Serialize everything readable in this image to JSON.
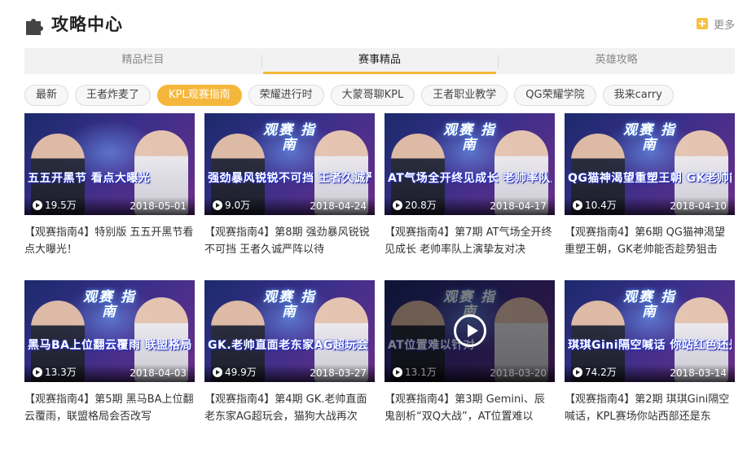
{
  "header": {
    "title": "攻略中心",
    "icon": "puzzle-icon",
    "more_label": "更多",
    "accent": "#f5b73b"
  },
  "tabs": [
    {
      "label": "精品栏目",
      "active": false
    },
    {
      "label": "赛事精品",
      "active": true
    },
    {
      "label": "英雄攻略",
      "active": false
    }
  ],
  "categories": [
    {
      "label": "最新",
      "active": false
    },
    {
      "label": "王者炸麦了",
      "active": false
    },
    {
      "label": "KPL观赛指南",
      "active": true
    },
    {
      "label": "荣耀进行时",
      "active": false
    },
    {
      "label": "大蒙哥聊KPL",
      "active": false
    },
    {
      "label": "王者职业教学",
      "active": false
    },
    {
      "label": "QG荣耀学院",
      "active": false
    },
    {
      "label": "我来carry",
      "active": false
    }
  ],
  "videos": [
    {
      "thumb_text": "五五开黑节 看点大曝光",
      "logo": "",
      "views": "19.5万",
      "date": "2018-05-01",
      "title": "【观赛指南4】特别版 五五开黑节看点大曝光！",
      "hover": false
    },
    {
      "thumb_text": "强劲暴风锐锐不可挡 王者久诚严阵以待",
      "logo": "观赛 指南",
      "views": "9.0万",
      "date": "2018-04-24",
      "title": "【观赛指南4】第8期 强劲暴风锐锐不可挡 王者久诚严阵以待",
      "hover": false
    },
    {
      "thumb_text": "AT气场全开终见成长 老帅率队上演挚友对决",
      "logo": "观赛 指南",
      "views": "20.8万",
      "date": "2018-04-17",
      "title": "【观赛指南4】第7期 AT气场全开终见成长 老帅率队上演挚友对决",
      "hover": false
    },
    {
      "thumb_text": "QG猫神渴望重塑王朝 GK老帅能否趁势狙击",
      "logo": "观赛 指南",
      "views": "10.4万",
      "date": "2018-04-10",
      "title": "【观赛指南4】第6期 QG猫神渴望重塑王朝，GK老帅能否趁势狙击",
      "hover": false
    },
    {
      "thumb_text": "黑马BA上位翻云覆雨 联盟格局会否改写",
      "logo": "观赛 指南",
      "views": "13.3万",
      "date": "2018-04-03",
      "title": "【观赛指南4】第5期 黑马BA上位翻云覆雨，联盟格局会否改写",
      "hover": false
    },
    {
      "thumb_text": "GK.老帅直面老东家AG超玩会 猫狗大战再次上演",
      "logo": "观赛 指南",
      "views": "49.9万",
      "date": "2018-03-27",
      "title": "【观赛指南4】第4期 GK.老帅直面老东家AG超玩会，猫狗大战再次",
      "hover": false
    },
    {
      "thumb_text": "AT位置难以针对",
      "logo": "观赛 指南",
      "views": "13.1万",
      "date": "2018-03-20",
      "title": "【观赛指南4】第3期 Gemini、辰鬼剖析“双Q大战”，AT位置难以",
      "hover": true
    },
    {
      "thumb_text": "琪琪Gini隔空喊话 你站红色还是蓝色",
      "logo": "观赛 指南",
      "views": "74.2万",
      "date": "2018-03-14",
      "title": "【观赛指南4】第2期 琪琪Gini隔空喊话，KPL赛场你站西部还是东",
      "hover": false
    }
  ]
}
